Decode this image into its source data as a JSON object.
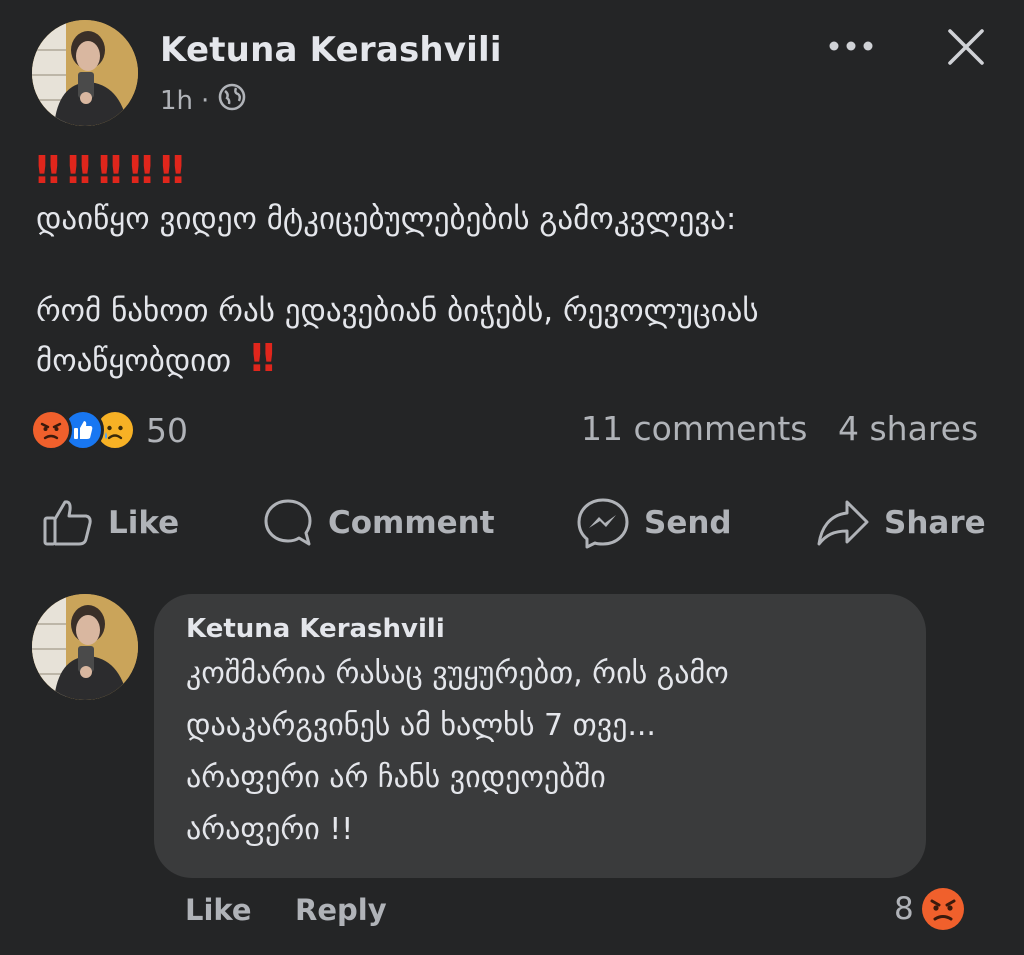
{
  "post": {
    "author": "Ketuna Kerashvili",
    "time": "1h",
    "audience_icon": "globe-icon",
    "bangs": [
      "‼",
      "‼",
      "‼",
      "‼",
      "‼"
    ],
    "line1": "დაიწყო ვიდეო მტკიცებულებების გამოკვლევა:",
    "line2": "რომ ნახოთ რას ედავებიან ბიჭებს, რევოლუციას",
    "line3": "მოაწყობდით",
    "line3_mark": "‼"
  },
  "header": {
    "more_icon": "more-options-icon",
    "close_icon": "close-icon"
  },
  "stats": {
    "reaction_icons": [
      "angry-icon",
      "like-icon",
      "sad-icon"
    ],
    "reaction_count": "50",
    "comments": "11 comments",
    "shares": "4 shares"
  },
  "actions": {
    "like": "Like",
    "comment": "Comment",
    "send": "Send",
    "share": "Share"
  },
  "comment": {
    "author": "Ketuna Kerashvili",
    "lines": [
      "კოშმარია რასაც ვუყურებთ, რის გამო",
      "დააკარგვინეს ამ ხალხს 7 თვე...",
      "არაფერი არ ჩანს ვიდეოებში",
      "არაფერი !!"
    ],
    "like": "Like",
    "reply": "Reply",
    "reaction_count": "8",
    "reaction_icon": "angry-icon"
  },
  "colors": {
    "background": "#242526",
    "bubble": "#3a3b3c",
    "primary_text": "#e4e6eb",
    "secondary_text": "#b0b3b8",
    "bang_red": "#e0261c",
    "like_blue": "#1877f2",
    "angry_orange": "#f0602c",
    "sad_yellow": "#f7b125"
  }
}
